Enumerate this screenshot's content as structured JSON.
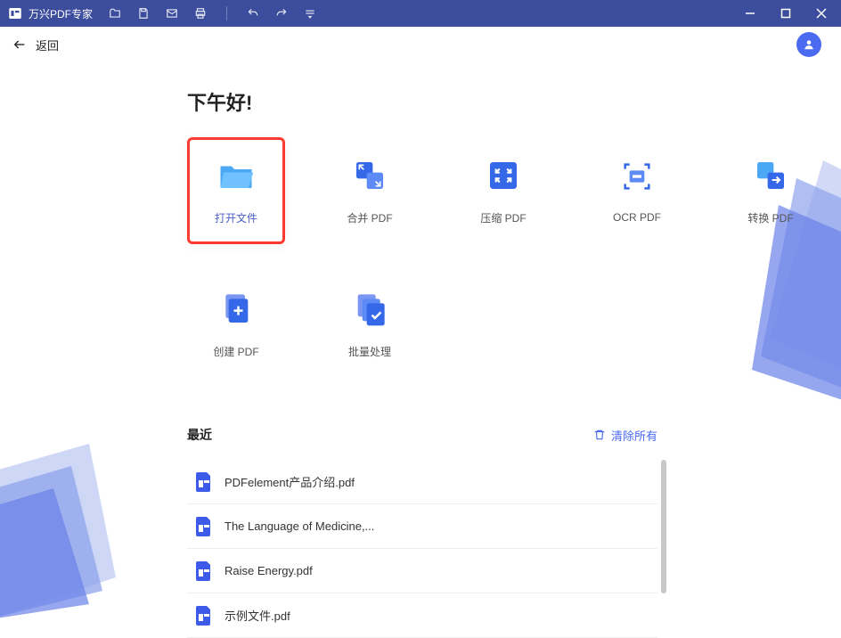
{
  "app": {
    "title": "万兴PDF专家"
  },
  "header": {
    "back": "返回"
  },
  "greeting": "下午好!",
  "actions": [
    {
      "label": "打开文件",
      "highlighted": true
    },
    {
      "label": "合并 PDF"
    },
    {
      "label": "压缩 PDF"
    },
    {
      "label": "OCR PDF"
    },
    {
      "label": "转换 PDF"
    },
    {
      "label": "创建 PDF"
    },
    {
      "label": "批量处理"
    }
  ],
  "recent": {
    "title": "最近",
    "clearAll": "清除所有",
    "items": [
      {
        "name": "PDFelement产品介绍.pdf"
      },
      {
        "name": "The Language of Medicine,..."
      },
      {
        "name": "Raise Energy.pdf"
      },
      {
        "name": "示例文件.pdf"
      }
    ]
  }
}
